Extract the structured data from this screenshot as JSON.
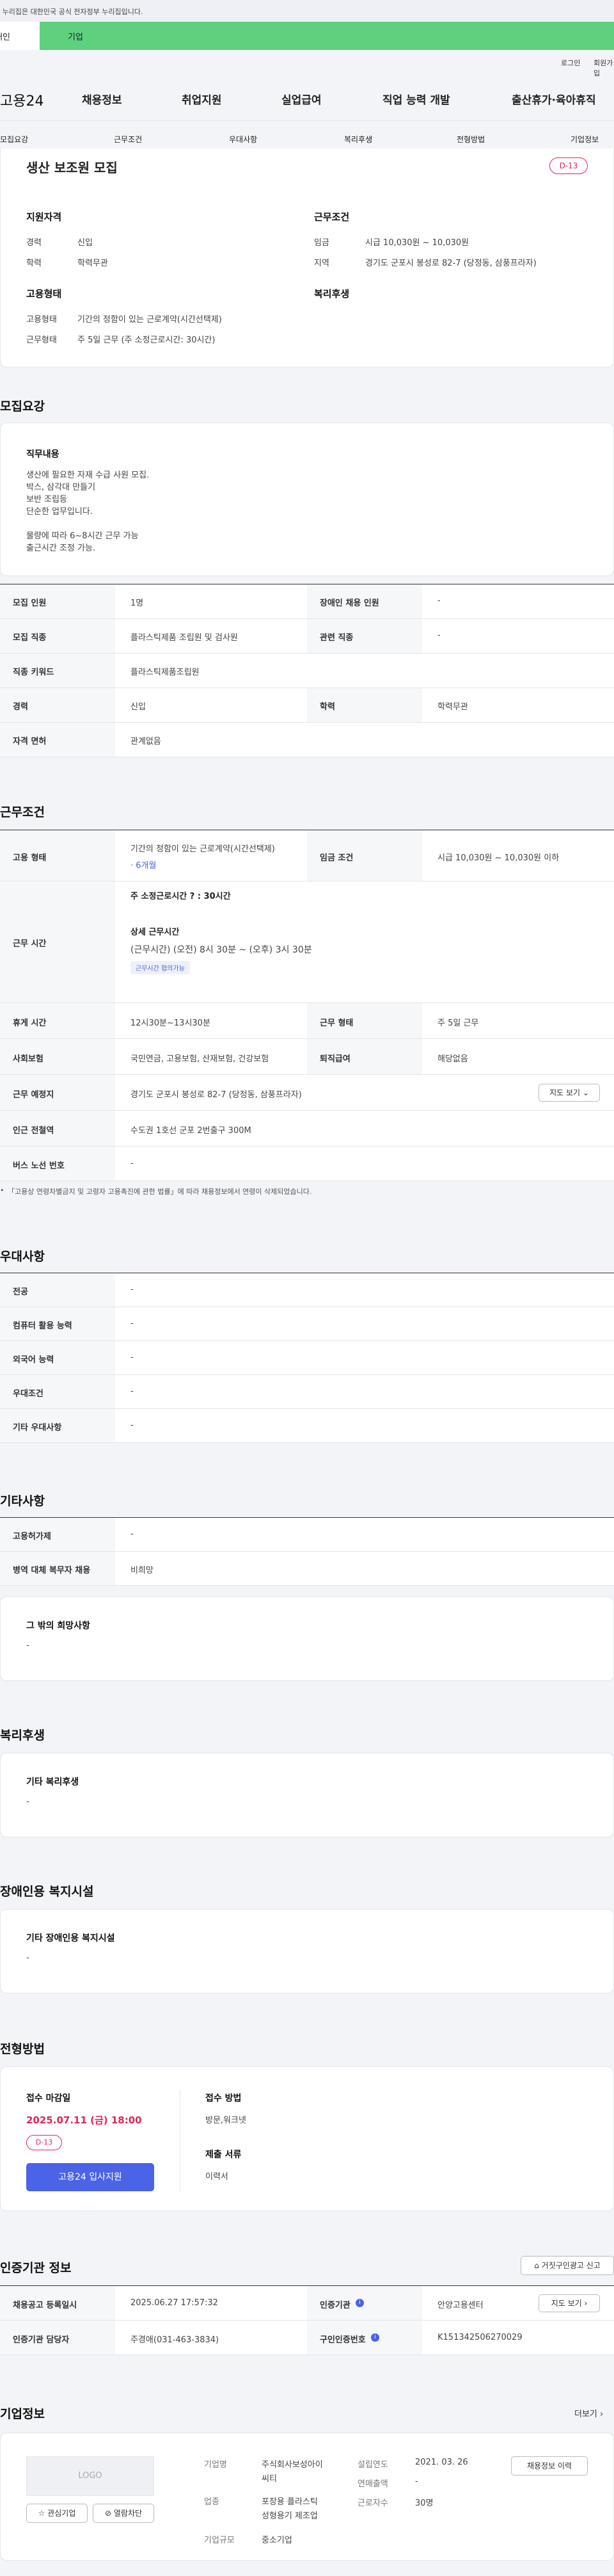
{
  "gov_banner": "이 누리집은 대한민국 공식 전자정부 누리집입니다.",
  "topnav": {
    "tab_individual": "개인",
    "tab_company": "기업",
    "login": "로그인",
    "signup": "회원가입"
  },
  "logo": "고용24",
  "mainnav": [
    "채용정보",
    "취업지원",
    "실업급여",
    "직업 능력 개발",
    "출산휴가·육아휴직"
  ],
  "subnav": [
    "모집요강",
    "근무조건",
    "우대사항",
    "복리후생",
    "전형방법",
    "기업정보"
  ],
  "job": {
    "title": "생산 보조원 모집",
    "dday": "D-13",
    "qual_title": "지원자격",
    "career_label": "경력",
    "career": "신입",
    "edu_label": "학력",
    "edu": "학력무관",
    "cond_title": "근무조건",
    "wage_label": "임금",
    "wage": "시급 10,030원 ~ 10,030원",
    "area_label": "지역",
    "area": "경기도 군포시 봉성로 82-7 (당정동, 삼풍프라자)",
    "emp_title": "고용형태",
    "emptype_label": "고용형태",
    "emptype": "기간의 정함이 있는 근로계약(시간선택제)",
    "worktype_label": "근무형태",
    "worktype": "주 5일 근무 (주 소정근로시간: 30시간)",
    "welfare_title": "복리후생"
  },
  "recruit": {
    "title": "모집요강",
    "duty_title": "직무내용",
    "duty_lines": [
      "생산에 필요한 자재 수급 사원 모집.",
      "박스, 삼각대 만들기",
      "보반 조립등",
      "단순한 업무입니다.",
      "",
      "물량에 따라 6~8시간 근무 가능",
      "출근시간 조정 가능."
    ],
    "headcount_k": "모집 인원",
    "headcount_v": "1명",
    "disabled_k": "장애인 채용 인원",
    "disabled_v": "-",
    "jobtype_k": "모집 직종",
    "jobtype_v": "플라스틱제품 조립원 및 검사원",
    "related_k": "관련 직종",
    "related_v": "-",
    "keyword_k": "직종 키워드",
    "keyword_v": "플라스틱제품조립원",
    "career_k": "경력",
    "career_v": "신입",
    "edu_k": "학력",
    "edu_v": "학력무관",
    "license_k": "자격 면허",
    "license_v": "관계없음"
  },
  "conditions": {
    "title": "근무조건",
    "emp_k": "고용 형태",
    "emp_v": "기간의 정함이 있는 근로계약(시간선택제)",
    "emp_period": "· 6개월",
    "wage_k": "임금 조건",
    "wage_v": "시급 10,030원 ~ 10,030원 이하",
    "time_k": "근무 시간",
    "weekly": "주 소정근로시간 ? : 30시간",
    "detail_title": "상세 근무시간",
    "detail": "(근무시간) (오전) 8시 30분 ~ (오후) 3시 30분",
    "flex_badge": "근무시간 협의가능",
    "break_k": "휴게 시간",
    "break_v": "12시30분~13시30분",
    "form_k": "근무 형태",
    "form_v": "주 5일 근무",
    "ins_k": "사회보험",
    "ins_v": "국민연금, 고용보험, 산재보험, 건강보험",
    "retire_k": "퇴직급여",
    "retire_v": "해당없음",
    "place_k": "근무 예정지",
    "place_v": "경기도 군포시 봉성로 82-7 (당정동, 삼풍프라자)",
    "map_btn": "지도 보기",
    "subway_k": "인근 전철역",
    "subway_v": "수도권 1호선 군포 2번출구 300M",
    "bus_k": "버스 노선 번호",
    "bus_v": "-",
    "note": "「고용상 연령차별금지 및 고령자 고용촉진에 관한 법률」에 따라 채용정보에서 연령이 삭제되었습니다."
  },
  "pref": {
    "title": "우대사항",
    "rows": [
      [
        "전공",
        "-"
      ],
      [
        "컴퓨터 활용 능력",
        "-"
      ],
      [
        "외국어 능력",
        "-"
      ],
      [
        "우대조건",
        "-"
      ],
      [
        "기타 우대사항",
        "-"
      ]
    ]
  },
  "etc": {
    "title": "기타사항",
    "rows": [
      [
        "고용허가제",
        "-"
      ],
      [
        "병역 대체 복무자 채용",
        "비희망"
      ]
    ],
    "other_title": "그 밖의 희망사항",
    "other_v": "-"
  },
  "welfare": {
    "title": "복리후생",
    "sub": "기타 복리후생",
    "v": "-"
  },
  "disab": {
    "title": "장애인용 복지시설",
    "sub": "기타 장애인용 복지시설",
    "v": "-"
  },
  "process": {
    "title": "전형방법",
    "deadline_label": "접수 마감일",
    "deadline": "2025.07.11 (금) 18:00",
    "dday": "D-13",
    "apply_btn": "고용24 입사지원",
    "method_label": "접수 방법",
    "method": "방문,워크넷",
    "docs_label": "제출 서류",
    "docs": "이력서"
  },
  "cert": {
    "title": "인증기관 정보",
    "report_btn": "거짓구인광고 신고",
    "reg_k": "채용공고 등록일시",
    "reg_v": "2025.06.27 17:57:32",
    "org_k": "인증기관",
    "org_v": "안양고용센터",
    "map_btn": "지도 보기",
    "mgr_k": "인증기관 담당자",
    "mgr_v": "주경애(031-463-3834)",
    "no_k": "구인인증번호",
    "no_v": "K151342506270029"
  },
  "company": {
    "title": "기업정보",
    "more": "더보기",
    "logo_text": "LOGO",
    "interest_btn": "관심기업",
    "block_btn": "열람차단",
    "name_k": "기업명",
    "name_v1": "주식회사보성아이",
    "name_v2": "씨티",
    "biz_k": "업종",
    "biz_v1": "포장용 플라스틱",
    "biz_v2": "성형용기 제조업",
    "size_k": "기업규모",
    "size_v": "중소기업",
    "est_k": "설립연도",
    "est_v": "2021. 03. 26",
    "sales_k": "연매출액",
    "sales_v": "-",
    "emp_k": "근로자수",
    "emp_v": "30명",
    "jobs_btn": "채용정보 이력"
  },
  "colors": {
    "accent_green": "#5fd07e",
    "primary": "#4a63e7",
    "danger": "#e1245a"
  }
}
